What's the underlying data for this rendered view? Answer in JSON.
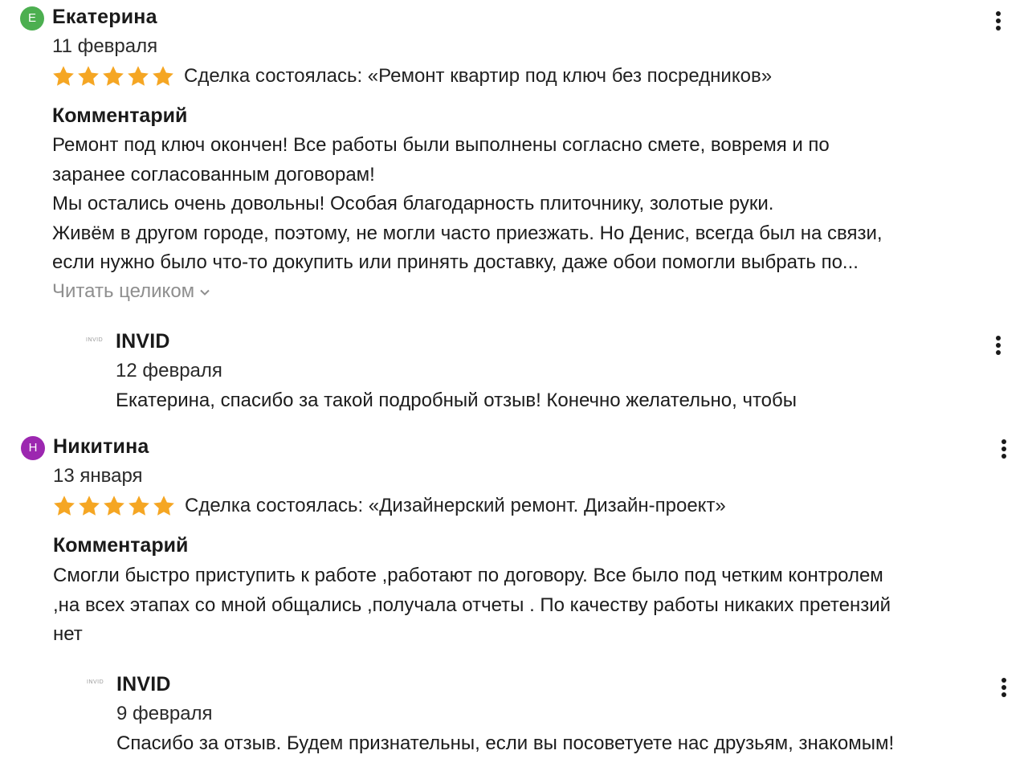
{
  "reviews": [
    {
      "avatar_letter": "Е",
      "avatar_color": "#4caf50",
      "author": "Екатерина",
      "date": "11 февраля",
      "rating": 5,
      "deal": "Сделка состоялась: «Ремонт квартир под ключ без посредников»",
      "comment_label": "Комментарий",
      "comment_lines": [
        "Ремонт под ключ окончен! Все работы были выполнены согласно смете, вовремя и по",
        "заранее согласованным договорам!",
        "Мы остались очень довольны! Особая благодарность плиточнику, золотые руки.",
        "Живём в другом городе, поэтому, не могли часто приезжать. Но Денис, всегда был на связи,",
        "если нужно было что-то докупить или принять доставку, даже обои помогли выбрать по..."
      ],
      "read_more": "Читать целиком",
      "reply": {
        "logo_text": "INVID",
        "author": "INVID",
        "date": "12 февраля",
        "text": "Екатерина, спасибо за такой подробный отзыв! Конечно желательно, чтобы"
      }
    },
    {
      "avatar_letter": "Н",
      "avatar_color": "#9c27b0",
      "author": "Никитина",
      "date": "13 января",
      "rating": 5,
      "deal": "Сделка состоялась: «Дизайнерский ремонт. Дизайн-проект»",
      "comment_label": "Комментарий",
      "comment_lines": [
        "Смогли быстро приступить к работе ,работают по договору. Все было под четким контролем",
        ",на всех этапах со мной общались ,получала отчеты . По качеству работы никаких претензий",
        "нет"
      ],
      "reply": {
        "logo_text": "INVID",
        "author": "INVID",
        "date": "9 февраля",
        "text": "Спасибо за отзыв. Будем признательны, если вы посоветуете нас друзьям, знакомым!"
      }
    }
  ],
  "colors": {
    "star": "#f5a623",
    "muted_text": "#8e8e8e"
  },
  "icons": {
    "star": "star-icon",
    "more": "more-vertical-icon",
    "chevron": "chevron-down-icon"
  }
}
